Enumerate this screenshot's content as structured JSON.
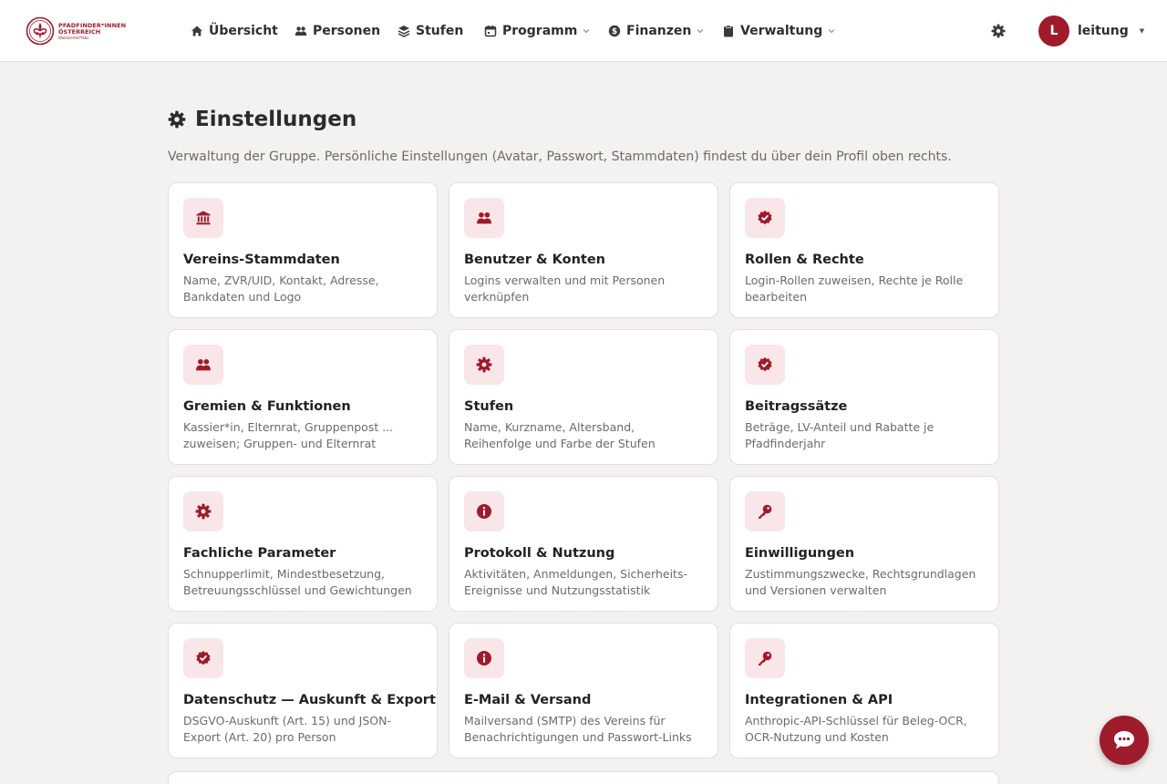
{
  "brand": {
    "line1": "PFADFINDER*INNEN",
    "line2": "ÖSTERREICH",
    "line3": "Waldviertel/Ybbs",
    "color": "#9e1b2b"
  },
  "nav": {
    "items": [
      {
        "label": "Übersicht",
        "icon": "home-icon"
      },
      {
        "label": "Personen",
        "icon": "users-icon"
      },
      {
        "label": "Stufen",
        "icon": "layers-icon"
      },
      {
        "label": "Programm",
        "icon": "calendar-icon",
        "dropdown": true
      },
      {
        "label": "Finanzen",
        "icon": "dollar-icon",
        "dropdown": true
      },
      {
        "label": "Verwaltung",
        "icon": "clipboard-icon",
        "dropdown": true
      }
    ]
  },
  "user": {
    "initial": "L",
    "name": "leitung",
    "caret": "▼"
  },
  "page": {
    "title": "Einstellungen",
    "subtitle": "Verwaltung der Gruppe. Persönliche Einstellungen (Avatar, Passwort, Stammdaten) findest du über dein Profil oben rechts."
  },
  "cards": [
    {
      "title": "Vereins-Stammdaten",
      "desc": "Name, ZVR/UID, Kontakt, Adresse, Bankdaten und Logo",
      "icon": "bank-icon"
    },
    {
      "title": "Benutzer & Konten",
      "desc": "Logins verwalten und mit Personen verknüpfen",
      "icon": "users-icon"
    },
    {
      "title": "Rollen & Rechte",
      "desc": "Login-Rollen zuweisen, Rechte je Rolle bearbeiten",
      "icon": "badge-check-icon"
    },
    {
      "title": "Gremien & Funktionen",
      "desc": "Kassier*in, Elternrat, Gruppenpost ... zuweisen; Gruppen- und Elternrat",
      "icon": "users-icon"
    },
    {
      "title": "Stufen",
      "desc": "Name, Kurzname, Altersband, Reihenfolge und Farbe der Stufen",
      "icon": "gear-icon"
    },
    {
      "title": "Beitragssätze",
      "desc": "Beträge, LV-Anteil und Rabatte je Pfadfinderjahr",
      "icon": "badge-check-icon"
    },
    {
      "title": "Fachliche Parameter",
      "desc": "Schnupperlimit, Mindestbesetzung, Betreuungsschlüssel und Gewichtungen",
      "icon": "gear-icon"
    },
    {
      "title": "Protokoll & Nutzung",
      "desc": "Aktivitäten, Anmeldungen, Sicherheits-Ereignisse und Nutzungsstatistik",
      "icon": "info-icon"
    },
    {
      "title": "Einwilligungen",
      "desc": "Zustimmungszwecke, Rechtsgrundlagen und Versionen verwalten",
      "icon": "key-icon"
    },
    {
      "title": "Datenschutz — Auskunft & Export",
      "desc": "DSGVO-Auskunft (Art. 15) und JSON-Export (Art. 20) pro Person",
      "icon": "badge-check-icon"
    },
    {
      "title": "E-Mail & Versand",
      "desc": "Mailversand (SMTP) des Vereins für Benachrichtigungen und Passwort-Links",
      "icon": "info-icon"
    },
    {
      "title": "Integrationen & API",
      "desc": "Anthropic-API-Schlüssel für Beleg-OCR, OCR-Nutzung und Kosten",
      "icon": "key-icon"
    }
  ]
}
